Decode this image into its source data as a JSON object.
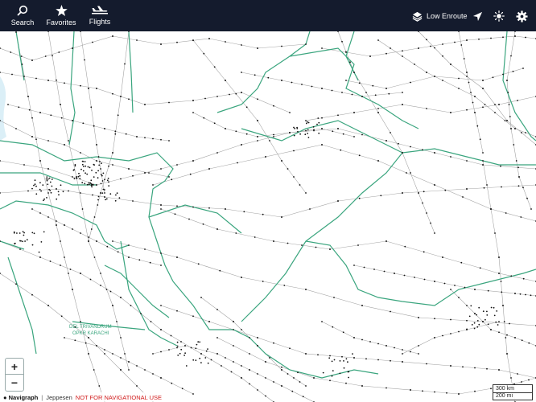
{
  "toolbar": {
    "search_label": "Search",
    "favorites_label": "Favorites",
    "flights_label": "Flights",
    "layer_label": "Low Enroute",
    "icons": [
      "search-icon",
      "star-icon",
      "airplane-icon",
      "layers-icon",
      "location-arrow-icon",
      "sun-icon",
      "gear-icon"
    ]
  },
  "map": {
    "region_label_1": "DEL TRIVANDRUM",
    "region_label_2": "OPKR KARACHI",
    "colors": {
      "boundary": "#3aa57e",
      "airway": "#a4a4a4",
      "fix": "#111111",
      "background": "#ffffff",
      "toolbar": "#141b2d"
    }
  },
  "zoom": {
    "in_label": "+",
    "out_label": "−"
  },
  "footer": {
    "brand": "● Navigraph",
    "sep": "|",
    "provider": "Jeppesen",
    "warning": "NOT FOR NAVIGATIONAL USE"
  },
  "scale": {
    "km_label": "300 km",
    "mi_label": "200 mi"
  }
}
